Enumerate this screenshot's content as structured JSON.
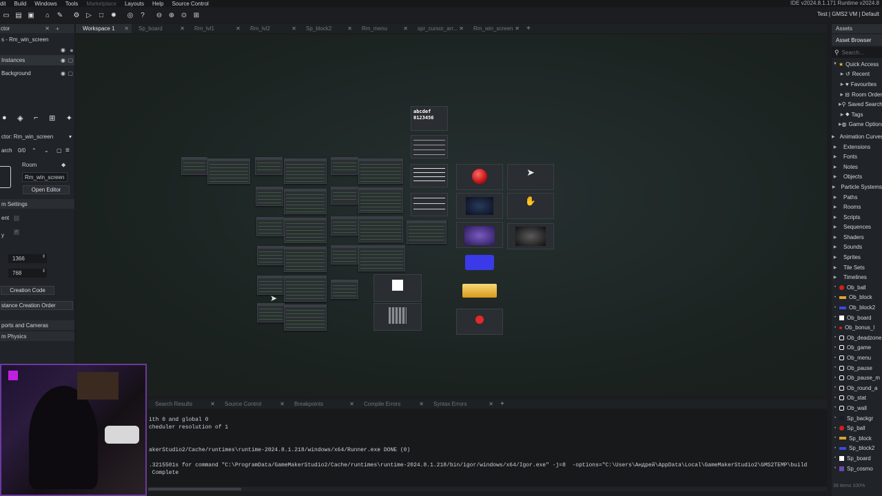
{
  "menu": {
    "items": [
      {
        "label": "dit",
        "disabled": false
      },
      {
        "label": "Build",
        "disabled": false
      },
      {
        "label": "Windows",
        "disabled": false
      },
      {
        "label": "Tools",
        "disabled": false
      },
      {
        "label": "Marketplace",
        "disabled": true
      },
      {
        "label": "Layouts",
        "disabled": false
      },
      {
        "label": "Help",
        "disabled": false
      },
      {
        "label": "Source Control",
        "disabled": false
      }
    ],
    "ide_info": "IDE v2024.8.1.171  Runtime v2024.8",
    "target": "Test  |  GMS2 VM  |  Default"
  },
  "toolbar": {
    "icons": [
      "new-file-icon",
      "open-folder-icon",
      "save-icon",
      "build-icon",
      "clean-icon",
      "settings-icon",
      "run-icon",
      "stop-icon",
      "debug-icon",
      "target-icon",
      "help-icon",
      "zoom-out-icon",
      "zoom-in-icon",
      "zoom-fit-icon",
      "grid-icon"
    ]
  },
  "left": {
    "tab_label": "ctor",
    "layers_title": "s - Rm_win_screen",
    "layers": [
      {
        "label": "Instances",
        "selected": true
      },
      {
        "label": "Background",
        "selected": false
      }
    ],
    "inspector_title": "ctor: Rm_win_screen",
    "search_label": "arch",
    "search_count": "0/0",
    "room_label": "Room",
    "room_name": "Rm_win_screen",
    "open_editor": "Open Editor",
    "room_settings": "m Settings",
    "persistent_label": "ent",
    "clear_label": "y",
    "width": "1366",
    "height": "768",
    "creation_code": "Creation Code",
    "instance_order": "stance Creation Order",
    "viewports": "ports and Cameras",
    "physics": "m Physics"
  },
  "tabs": [
    {
      "label": "Workspace 1",
      "active": true
    },
    {
      "label": "Sp_board",
      "active": false
    },
    {
      "label": "Rm_lvl1",
      "active": false
    },
    {
      "label": "Rm_lvl2",
      "active": false
    },
    {
      "label": "Sp_block2",
      "active": false
    },
    {
      "label": "Rm_menu",
      "active": false
    },
    {
      "label": "spr_cursor_arr...",
      "active": false
    },
    {
      "label": "Rm_win_screen",
      "active": false
    }
  ],
  "workspace": {
    "font_thumb_lines": [
      "abcdef",
      "0123456"
    ]
  },
  "bottom_tabs": [
    {
      "label": "Search Results"
    },
    {
      "label": "Source Control"
    },
    {
      "label": "Breakpoints"
    },
    {
      "label": "Compile Errors"
    },
    {
      "label": "Syntax Errors"
    }
  ],
  "output_lines": [
    "ith 0 and global 0",
    "cheduler resolution of 1",
    "",
    "",
    "akerStudio2/Cache/runtimes\\runtime-2024.8.1.218/windows/x64/Runner.exe DONE (0)",
    "",
    ".3215501s for command \"C:\\ProgramData/GameMakerStudio2/Cache/runtimes\\runtime-2024.8.1.218/bin/igor/windows/x64/Igor.exe\" -j=8  -options=\"C:\\Users\\Андрей\\AppData\\Local\\GameMakerStudio2\\GMS2TEMP\\build",
    " Complete"
  ],
  "assets": {
    "panel_tab": "Assets",
    "browser_title": "Asset Browser",
    "search_placeholder": "Search...",
    "quick_access": "Quick Access",
    "quick_items": [
      "Recent",
      "Favourites",
      "Room Order",
      "Saved Searches",
      "Tags",
      "Game Options"
    ],
    "folders": [
      "Animation Curves",
      "Extensions",
      "Fonts",
      "Notes",
      "Objects",
      "Particle Systems",
      "Paths",
      "Rooms",
      "Scripts",
      "Sequences",
      "Shaders",
      "Sounds",
      "Sprites",
      "Tile Sets",
      "Timelines"
    ],
    "objects": [
      {
        "label": "Ob_ball",
        "color": "#d02020",
        "shape": "dot"
      },
      {
        "label": "Ob_block",
        "color": "#e0a030",
        "shape": "bar"
      },
      {
        "label": "Ob_block2",
        "color": "#3a4ae0",
        "shape": "bar"
      },
      {
        "label": "Ob_board",
        "color": "#ffffff",
        "shape": "sq"
      },
      {
        "label": "Ob_bonus_l",
        "color": "#d02020",
        "shape": "smalldot"
      },
      {
        "label": "Ob_deadzone",
        "color": "#ffffff",
        "shape": "outline"
      },
      {
        "label": "Ob_game",
        "color": "#ffffff",
        "shape": "outline"
      },
      {
        "label": "Ob_menu",
        "color": "#ffffff",
        "shape": "outline"
      },
      {
        "label": "Ob_pause",
        "color": "#ffffff",
        "shape": "outline"
      },
      {
        "label": "Ob_pause_m",
        "color": "#ffffff",
        "shape": "outline"
      },
      {
        "label": "Ob_round_a",
        "color": "#ffffff",
        "shape": "outline"
      },
      {
        "label": "Ob_stat",
        "color": "#ffffff",
        "shape": "outline"
      },
      {
        "label": "Ob_wall",
        "color": "#ffffff",
        "shape": "outline"
      },
      {
        "label": "Sp_backgr",
        "color": "#1a1c2a",
        "shape": "sq"
      },
      {
        "label": "Sp_ball",
        "color": "#d02020",
        "shape": "dot"
      },
      {
        "label": "Sp_block",
        "color": "#e0a030",
        "shape": "bar"
      },
      {
        "label": "Sp_block2",
        "color": "#3a4ae0",
        "shape": "bar"
      },
      {
        "label": "Sp_board",
        "color": "#ffffff",
        "shape": "sq"
      },
      {
        "label": "Sp_cosmo",
        "color": "#6a4ab0",
        "shape": "sq"
      }
    ],
    "footer": "39 items  100%"
  }
}
